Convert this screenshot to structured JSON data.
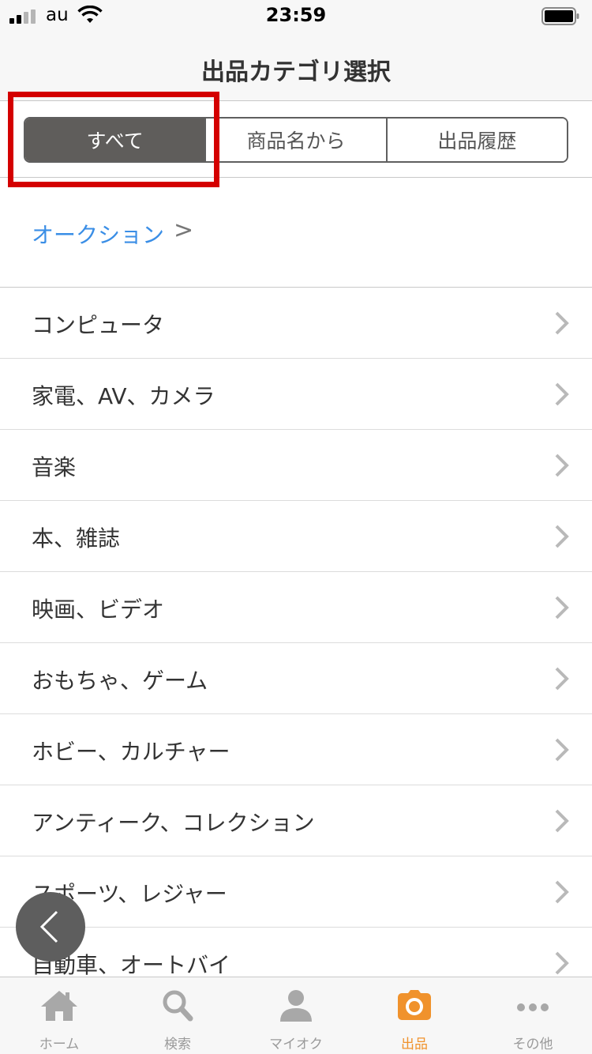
{
  "status_bar": {
    "carrier": "au",
    "time": "23:59"
  },
  "header": {
    "title": "出品カテゴリ選択"
  },
  "segments": [
    {
      "label": "すべて",
      "active": true
    },
    {
      "label": "商品名から",
      "active": false
    },
    {
      "label": "出品履歴",
      "active": false
    }
  ],
  "breadcrumb": {
    "label": "オークション",
    "chevron": ">"
  },
  "categories": [
    {
      "label": "コンピュータ"
    },
    {
      "label": "家電、AV、カメラ"
    },
    {
      "label": "音楽"
    },
    {
      "label": "本、雑誌"
    },
    {
      "label": "映画、ビデオ"
    },
    {
      "label": "おもちゃ、ゲーム"
    },
    {
      "label": "ホビー、カルチャー"
    },
    {
      "label": "アンティーク、コレクション"
    },
    {
      "label": "スポーツ、レジャー"
    },
    {
      "label": "自動車、オートバイ"
    }
  ],
  "tabs": [
    {
      "label": "ホーム",
      "icon": "home-icon",
      "active": false
    },
    {
      "label": "検索",
      "icon": "search-icon",
      "active": false
    },
    {
      "label": "マイオク",
      "icon": "person-icon",
      "active": false
    },
    {
      "label": "出品",
      "icon": "camera-icon",
      "active": true
    },
    {
      "label": "その他",
      "icon": "more-icon",
      "active": false
    }
  ],
  "colors": {
    "accent": "#f0922c",
    "link": "#3a8ee6",
    "segment_active": "#5f5d5b",
    "highlight": "#d40000",
    "tab_inactive": "#a8a8a8"
  }
}
